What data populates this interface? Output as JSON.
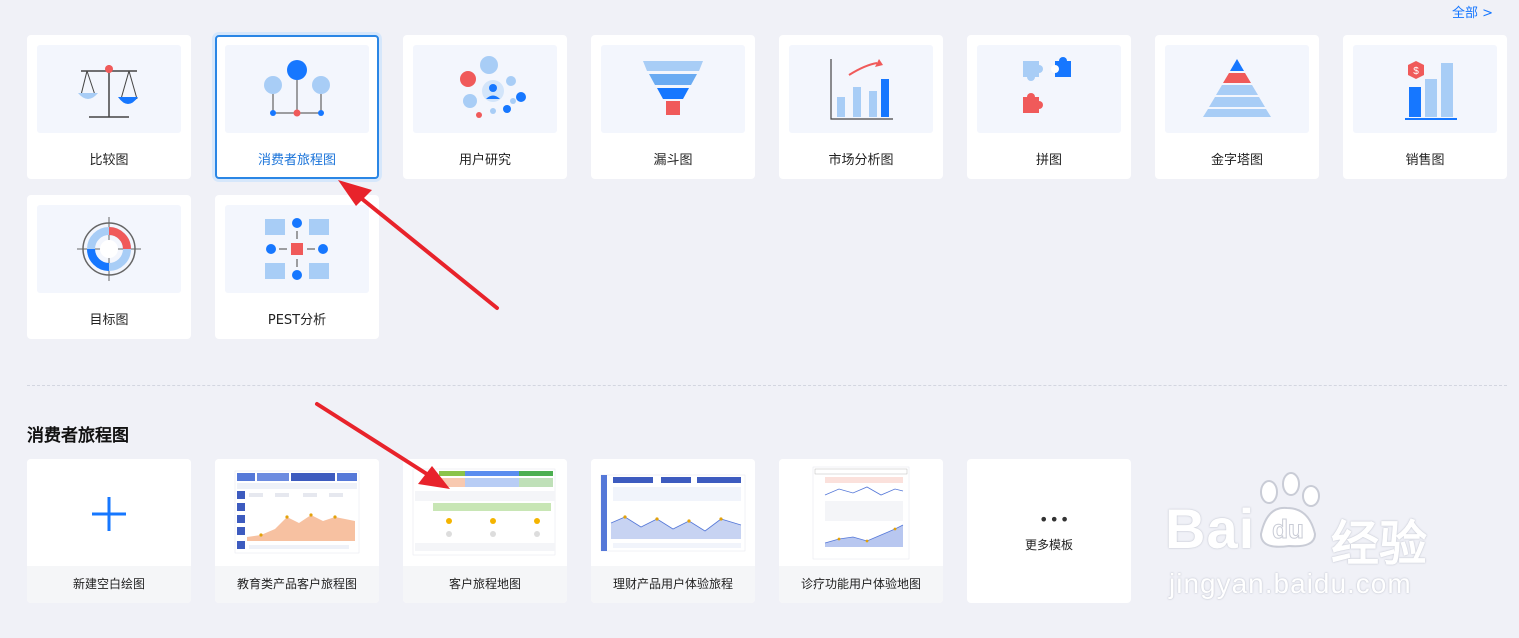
{
  "header": {
    "all_link": "全部 >"
  },
  "chart_types": [
    {
      "label": "比较图",
      "icon": "balance-scale-icon"
    },
    {
      "label": "消费者旅程图",
      "icon": "journey-nodes-icon",
      "selected": true
    },
    {
      "label": "用户研究",
      "icon": "user-research-icon"
    },
    {
      "label": "漏斗图",
      "icon": "funnel-icon"
    },
    {
      "label": "市场分析图",
      "icon": "market-chart-icon"
    },
    {
      "label": "拼图",
      "icon": "puzzle-icon"
    },
    {
      "label": "金字塔图",
      "icon": "pyramid-icon"
    },
    {
      "label": "销售图",
      "icon": "sales-chart-icon"
    },
    {
      "label": "目标图",
      "icon": "target-icon"
    },
    {
      "label": "PEST分析",
      "icon": "pest-grid-icon"
    }
  ],
  "section": {
    "title": "消费者旅程图"
  },
  "templates": [
    {
      "label": "新建空白绘图",
      "icon": "plus-icon"
    },
    {
      "label": "教育类产品客户旅程图"
    },
    {
      "label": "客户旅程地图"
    },
    {
      "label": "理财产品用户体验旅程"
    },
    {
      "label": "诊疗功能用户体验地图"
    }
  ],
  "more": {
    "dots": "•••",
    "label": "更多模板"
  },
  "watermark": {
    "main": "Bai",
    "cn": "经验",
    "du": "du",
    "sub": "jingyan.baidu.com"
  },
  "colors": {
    "accent": "#1677ff",
    "selected_border": "#2a86e5",
    "arrow": "#e8232b",
    "icon_blue": "#1677ff",
    "icon_light": "#a8cdf6",
    "icon_red": "#f05a5a"
  }
}
